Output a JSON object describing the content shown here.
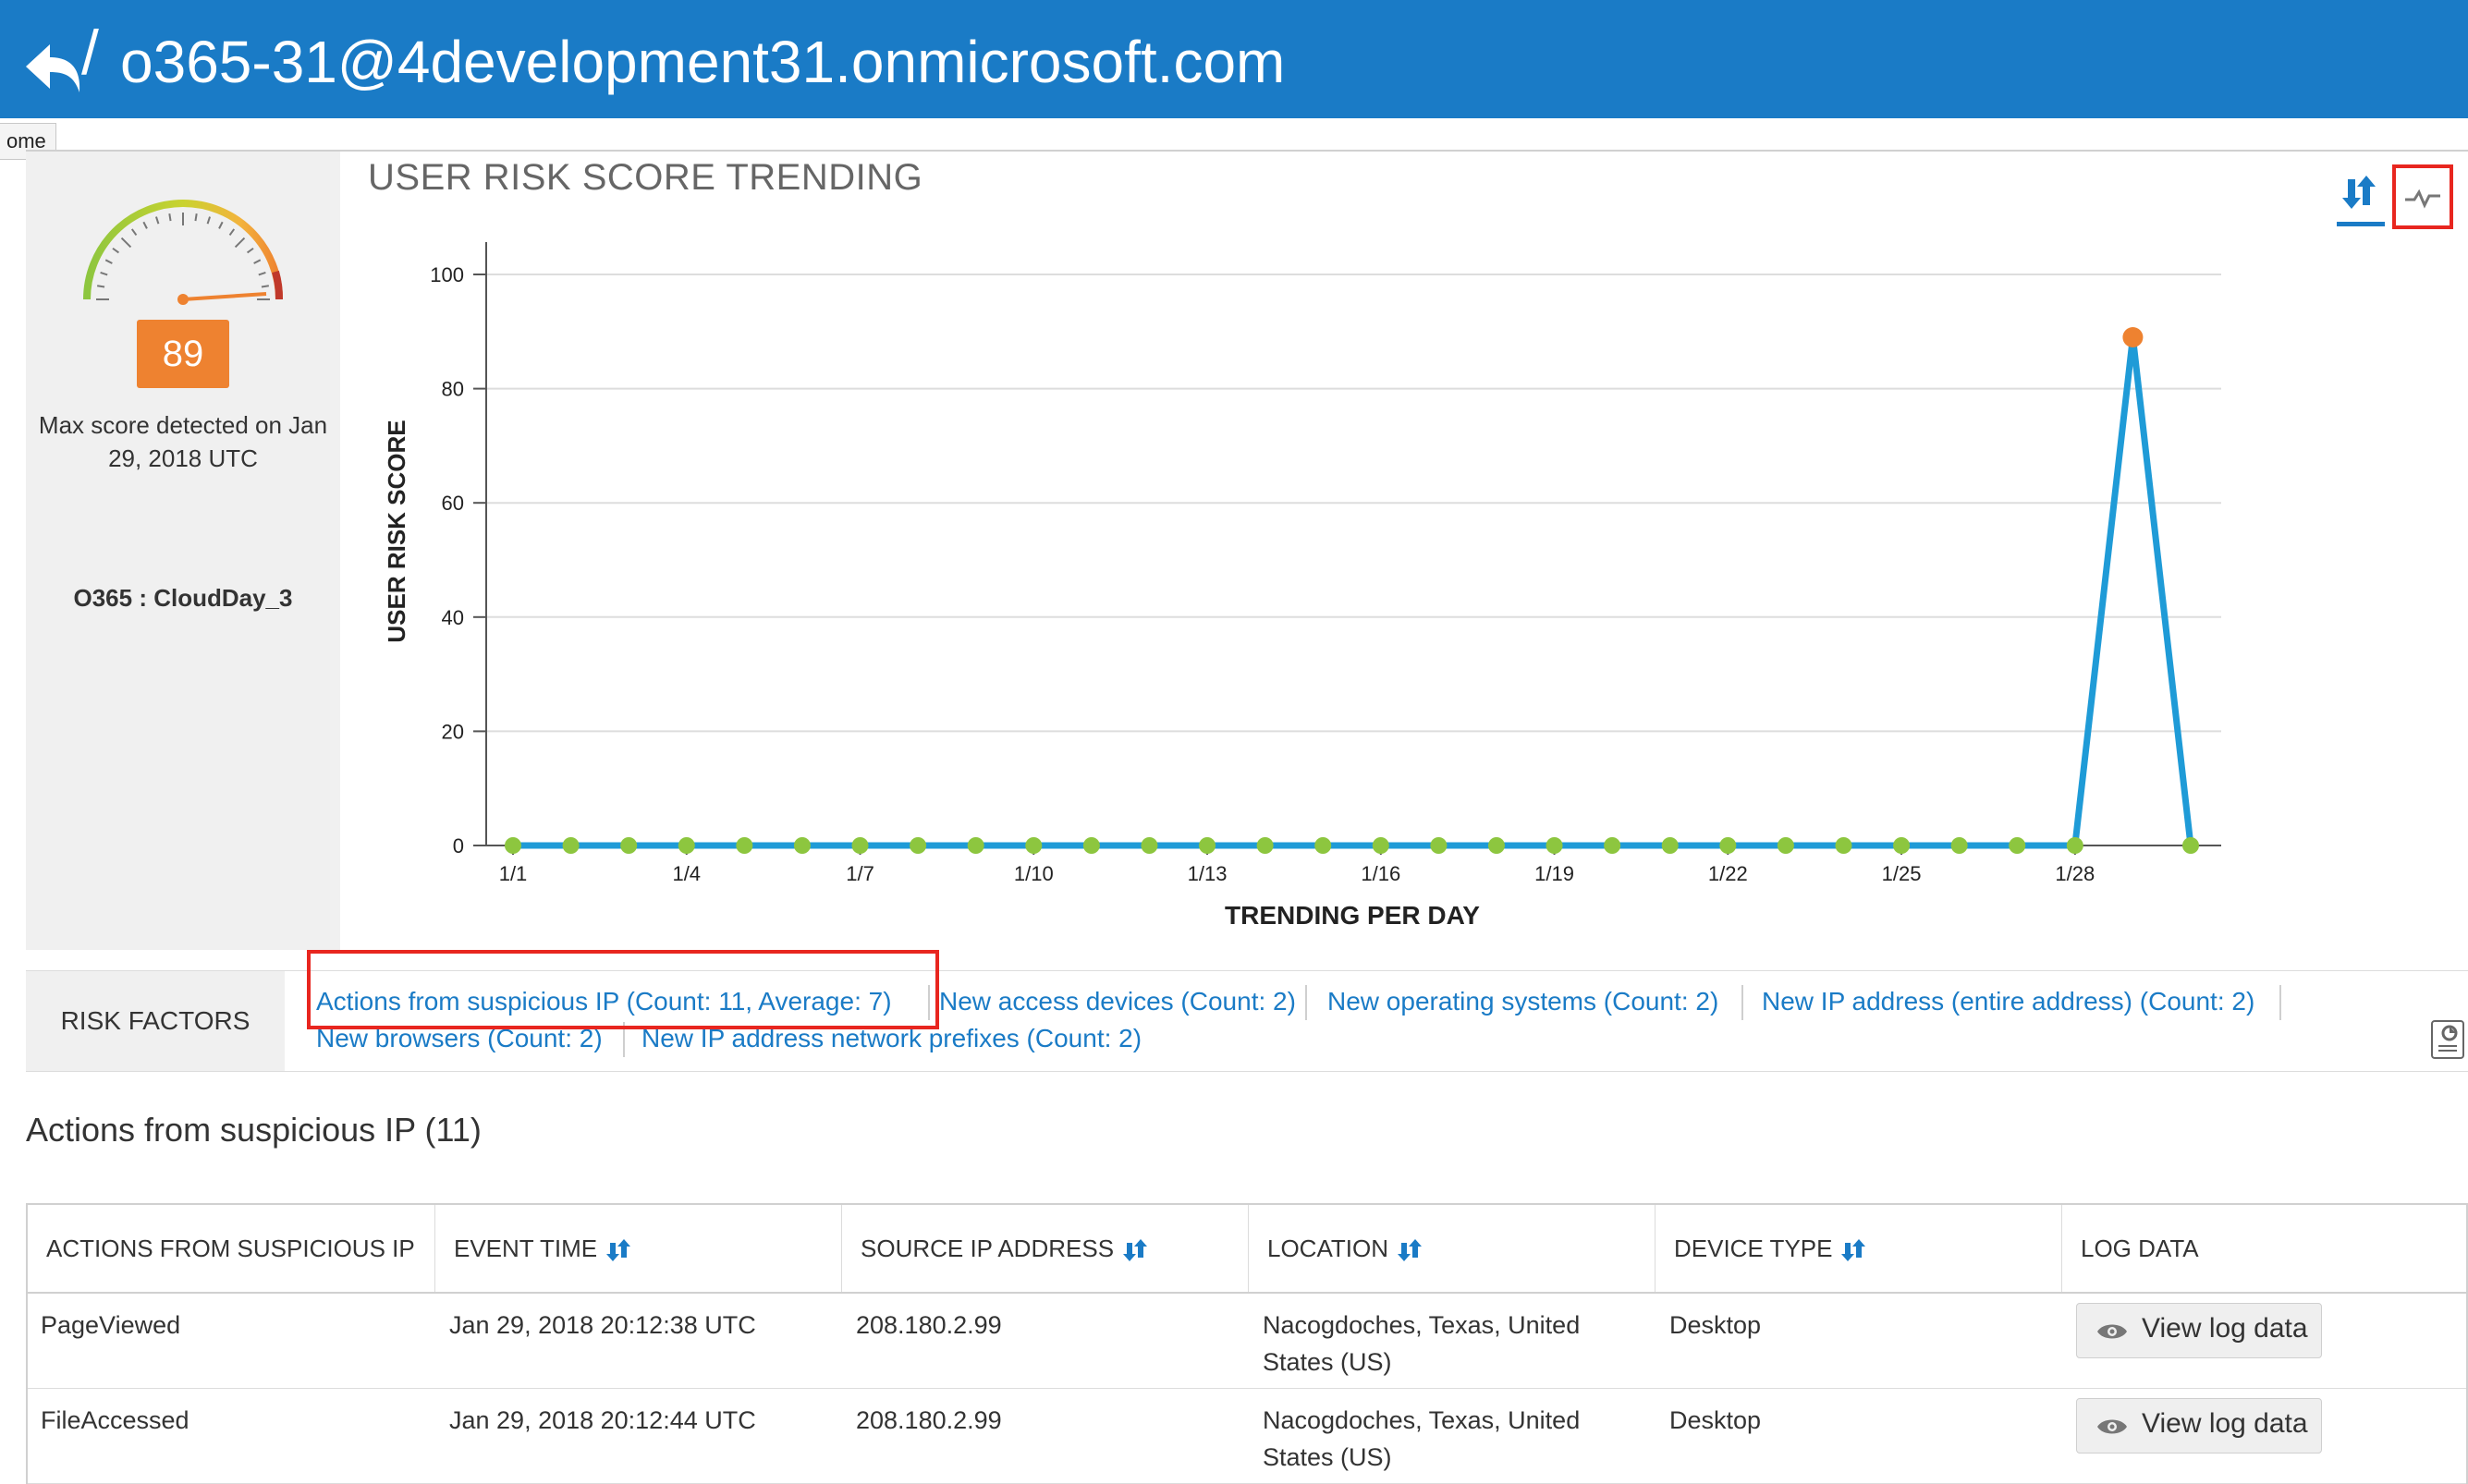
{
  "header": {
    "title": "o365-31@4development31.onmicrosoft.com",
    "tooltip": "ome"
  },
  "score_panel": {
    "score": "89",
    "max_score_text": "Max score detected on Jan 29, 2018 UTC",
    "account": "O365 : CloudDay_3"
  },
  "chart_title": "USER RISK SCORE TRENDING",
  "chart_data": {
    "type": "line",
    "title": "USER RISK SCORE TRENDING",
    "xlabel": "TRENDING PER DAY",
    "ylabel": "USER RISK SCORE",
    "ylim": [
      0,
      100
    ],
    "yticks": [
      0,
      20,
      40,
      60,
      80,
      100
    ],
    "xtick_labels": [
      "1/1",
      "1/4",
      "1/7",
      "1/10",
      "1/13",
      "1/16",
      "1/19",
      "1/22",
      "1/25",
      "1/28"
    ],
    "x": [
      "1/1",
      "1/2",
      "1/3",
      "1/4",
      "1/5",
      "1/6",
      "1/7",
      "1/8",
      "1/9",
      "1/10",
      "1/11",
      "1/12",
      "1/13",
      "1/14",
      "1/15",
      "1/16",
      "1/17",
      "1/18",
      "1/19",
      "1/20",
      "1/21",
      "1/22",
      "1/23",
      "1/24",
      "1/25",
      "1/26",
      "1/27",
      "1/28",
      "1/29",
      "1/30"
    ],
    "series": [
      {
        "values": [
          0,
          0,
          0,
          0,
          0,
          0,
          0,
          0,
          0,
          0,
          0,
          0,
          0,
          0,
          0,
          0,
          0,
          0,
          0,
          0,
          0,
          0,
          0,
          0,
          0,
          0,
          0,
          0,
          89,
          0
        ]
      }
    ],
    "grid": true,
    "colors": {
      "line": "#1f9bd7",
      "point": "#8dc63f",
      "max_point": "#ee8230"
    }
  },
  "risk_factors": {
    "label": "RISK FACTORS",
    "items": [
      "Actions from suspicious IP (Count: 11, Average: 7)",
      "New access devices (Count: 2)",
      "New operating systems (Count: 2)",
      "New IP address (entire address) (Count: 2)",
      "New browsers (Count: 2)",
      "New IP address network prefixes (Count: 2)"
    ]
  },
  "section_title": "Actions from suspicious IP (11)",
  "table": {
    "columns": [
      "ACTIONS FROM SUSPICIOUS IP",
      "EVENT TIME",
      "SOURCE IP ADDRESS",
      "LOCATION",
      "DEVICE TYPE",
      "LOG DATA"
    ],
    "rows": [
      {
        "action": "PageViewed",
        "time": "Jan 29, 2018 20:12:38 UTC",
        "ip": "208.180.2.99",
        "location_1": "Nacogdoches, Texas, United",
        "location_2": "States (US)",
        "device": "Desktop",
        "button": "View log data"
      },
      {
        "action": "FileAccessed",
        "time": "Jan 29, 2018 20:12:44 UTC",
        "ip": "208.180.2.99",
        "location_1": "Nacogdoches, Texas, United",
        "location_2": "States (US)",
        "device": "Desktop",
        "button": "View log data"
      }
    ]
  },
  "colors": {
    "brand": "#1a7bc6",
    "accent": "#ee8230",
    "highlight": "#e8261f"
  }
}
